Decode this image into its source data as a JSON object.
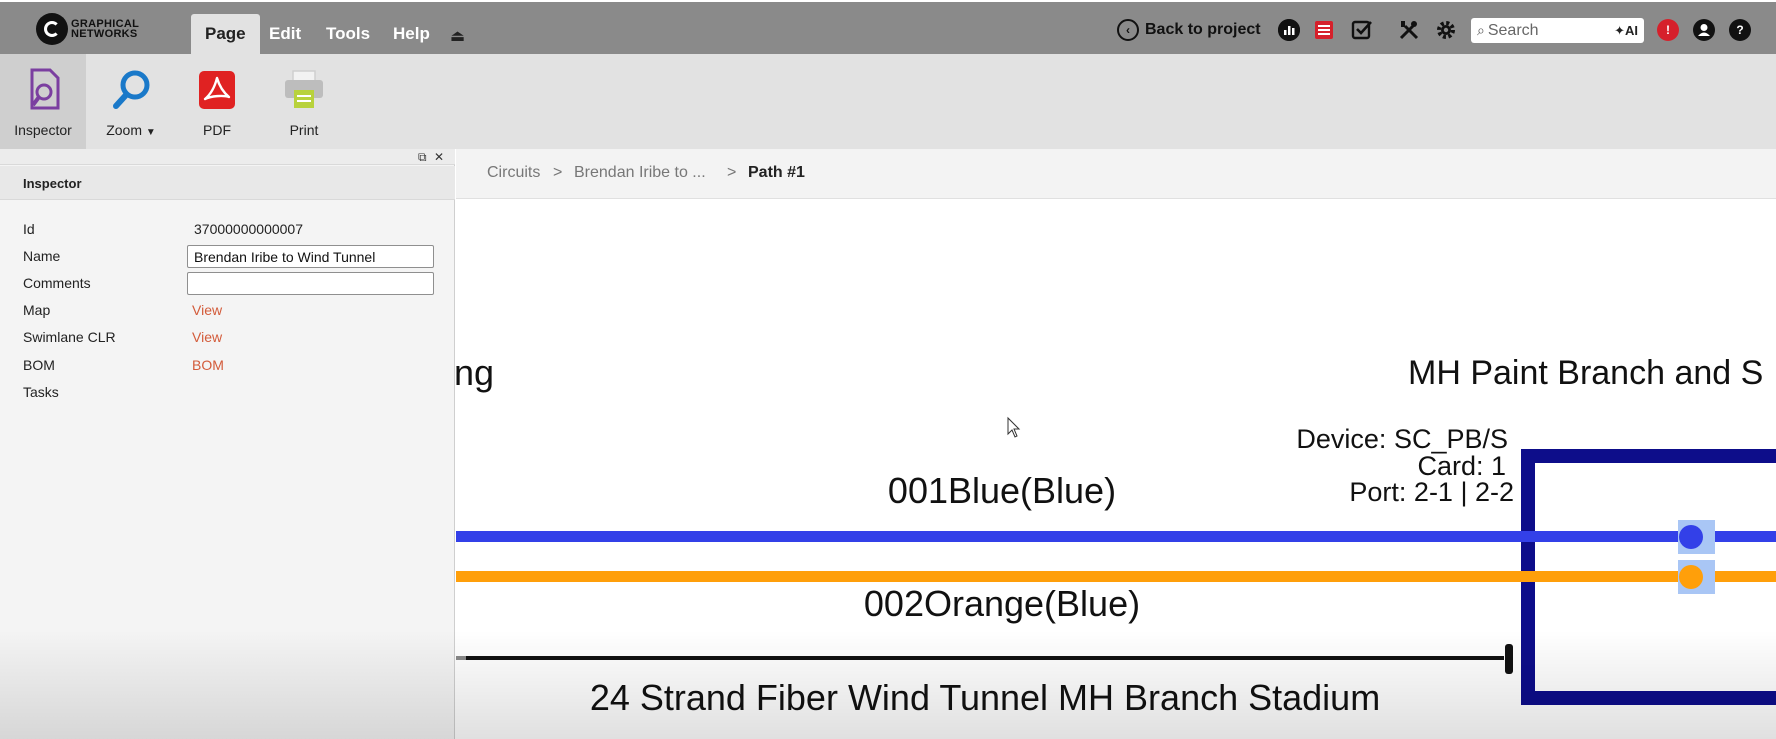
{
  "app": {
    "logo_text_line1": "GRAPHICAL",
    "logo_text_line2": "NETWORKS"
  },
  "menu": {
    "tabs": [
      {
        "label": "Page",
        "active": true
      },
      {
        "label": "Edit",
        "active": false
      },
      {
        "label": "Tools",
        "active": false
      },
      {
        "label": "Help",
        "active": false
      }
    ],
    "collapse_icon": "eject-icon"
  },
  "toolbar_right": {
    "back_label": "Back to project",
    "search_placeholder": "Search",
    "ai_label": "AI",
    "icons": [
      "chart-icon",
      "report-icon",
      "checklist-icon",
      "tools-icon",
      "gear-icon",
      "alert-icon",
      "user-icon",
      "help-icon"
    ]
  },
  "ribbon": {
    "buttons": [
      {
        "label": "Inspector",
        "icon": "inspector-icon",
        "active": true
      },
      {
        "label": "Zoom",
        "icon": "zoom-icon",
        "active": false
      },
      {
        "label": "PDF",
        "icon": "pdf-icon",
        "active": false
      },
      {
        "label": "Print",
        "icon": "print-icon",
        "active": false
      }
    ]
  },
  "inspector": {
    "title": "Inspector",
    "fields": {
      "id_label": "Id",
      "id_value": "37000000000007",
      "name_label": "Name",
      "name_value": "Brendan Iribe to Wind Tunnel",
      "comments_label": "Comments",
      "comments_value": "",
      "map_label": "Map",
      "map_link": "View",
      "swimlane_label": "Swimlane CLR",
      "swimlane_link": "View",
      "bom_label": "BOM",
      "bom_link": "BOM",
      "tasks_label": "Tasks"
    }
  },
  "breadcrumb": {
    "items": [
      "Circuits",
      "Brendan Iribe to ...",
      "Path #1"
    ],
    "separator": ">"
  },
  "diagram": {
    "left_fragment": "ng",
    "right_title": "MH Paint Branch and S",
    "device_line": "Device: SC_PB/S",
    "card_line": "Card: 1",
    "port_line": "Port: 2-1 | 2-2",
    "strand1_label": "001Blue(Blue)",
    "strand2_label": "002Orange(Blue)",
    "cable_label": "24 Strand Fiber Wind Tunnel MH Branch Stadium",
    "colors": {
      "blue_strand": "#3340e8",
      "orange_strand": "#ff9f0a",
      "device_border": "#0d0d8a",
      "port_highlight": "#a9c6f5"
    }
  }
}
